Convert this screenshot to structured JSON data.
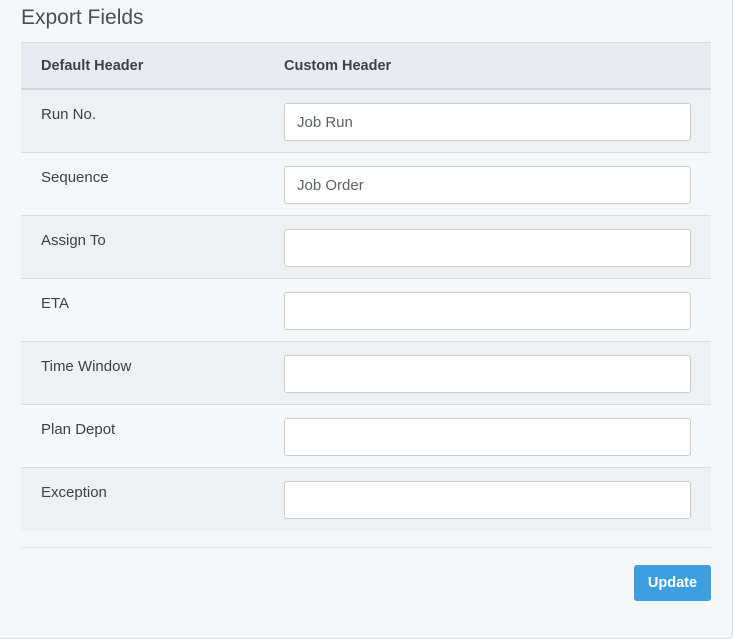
{
  "panel": {
    "title": "Export Fields"
  },
  "table": {
    "headers": {
      "default": "Default Header",
      "custom": "Custom Header"
    },
    "rows": [
      {
        "label": "Run No.",
        "value": "Job Run",
        "placeholder": ""
      },
      {
        "label": "Sequence",
        "value": "Job Order",
        "placeholder": ""
      },
      {
        "label": "Assign To",
        "value": "",
        "placeholder": ""
      },
      {
        "label": "ETA",
        "value": "",
        "placeholder": ""
      },
      {
        "label": "Time Window",
        "value": "",
        "placeholder": ""
      },
      {
        "label": "Plan Depot",
        "value": "",
        "placeholder": ""
      },
      {
        "label": "Exception",
        "value": "",
        "placeholder": ""
      }
    ]
  },
  "actions": {
    "update_label": "Update"
  },
  "colors": {
    "accent": "#3d9fe0",
    "panel_bg": "#f6f7f9",
    "header_bg": "#e8ecf0",
    "striped_row_bg": "#eff0f2"
  }
}
